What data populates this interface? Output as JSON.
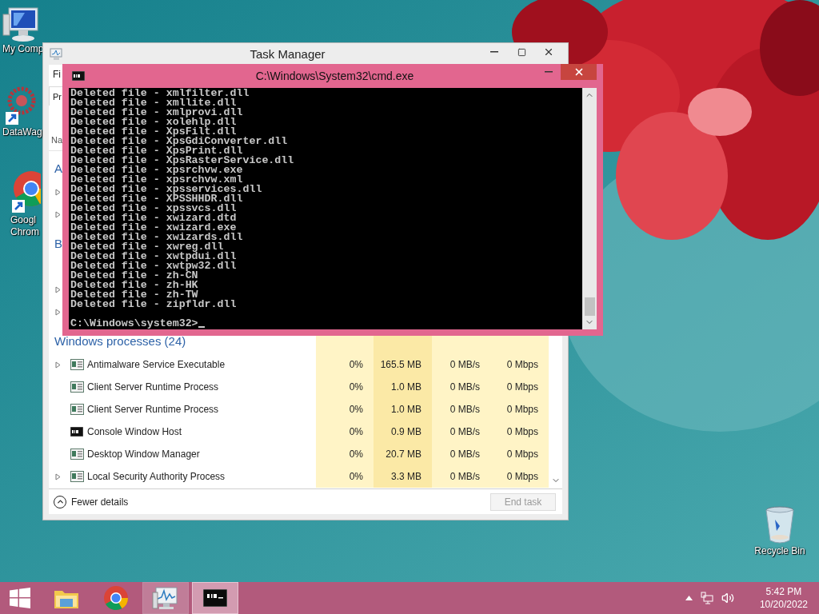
{
  "desktop": {
    "icons": [
      {
        "kind": "computer",
        "lines": [
          "My Comp"
        ]
      },
      {
        "kind": "shortcut_app",
        "lines": [
          "DataWag"
        ]
      },
      {
        "kind": "browser",
        "lines": [
          "Googl",
          "Chrom"
        ]
      },
      {
        "kind": "recycle_bin",
        "lines": [
          "Recycle Bin"
        ]
      }
    ]
  },
  "task_manager": {
    "title": "Task Manager",
    "menu": [
      "Fi"
    ],
    "tabs": [
      {
        "label": "Pr",
        "selected": true
      }
    ],
    "columns": [
      "Na"
    ],
    "groups": [
      {
        "heading": "A",
        "rows": [
          {
            "expandable": true
          },
          {
            "expandable": true
          }
        ]
      },
      {
        "heading": "B",
        "rows": [
          {
            "expandable": false
          },
          {
            "expandable": true
          },
          {
            "expandable": true
          }
        ]
      },
      {
        "heading": "Windows processes (24)",
        "rows": [
          {
            "expandable": true,
            "kind": "app",
            "name": "Antimalware Service Executable",
            "cpu": "0%",
            "memory": "165.5 MB",
            "disk": "0 MB/s",
            "network": "0 Mbps"
          },
          {
            "expandable": false,
            "kind": "app",
            "name": "Client Server Runtime Process",
            "cpu": "0%",
            "memory": "1.0 MB",
            "disk": "0 MB/s",
            "network": "0 Mbps"
          },
          {
            "expandable": false,
            "kind": "app",
            "name": "Client Server Runtime Process",
            "cpu": "0%",
            "memory": "1.0 MB",
            "disk": "0 MB/s",
            "network": "0 Mbps"
          },
          {
            "expandable": false,
            "kind": "console",
            "name": "Console Window Host",
            "cpu": "0%",
            "memory": "0.9 MB",
            "disk": "0 MB/s",
            "network": "0 Mbps"
          },
          {
            "expandable": false,
            "kind": "app",
            "name": "Desktop Window Manager",
            "cpu": "0%",
            "memory": "20.7 MB",
            "disk": "0 MB/s",
            "network": "0 Mbps"
          },
          {
            "expandable": true,
            "kind": "app",
            "name": "Local Security Authority Process",
            "cpu": "0%",
            "memory": "3.3 MB",
            "disk": "0 MB/s",
            "network": "0 Mbps"
          }
        ]
      }
    ],
    "fewer_details": "Fewer details",
    "end_task": {
      "label": "End task",
      "disabled": true
    }
  },
  "cmd": {
    "title": "C:\\Windows\\System32\\cmd.exe",
    "lines": [
      "Deleted file - xmlfilter.dll",
      "Deleted file - xmllite.dll",
      "Deleted file - xmlprovi.dll",
      "Deleted file - xolehlp.dll",
      "Deleted file - XpsFilt.dll",
      "Deleted file - XpsGdiConverter.dll",
      "Deleted file - XpsPrint.dll",
      "Deleted file - XpsRasterService.dll",
      "Deleted file - xpsrchvw.exe",
      "Deleted file - xpsrchvw.xml",
      "Deleted file - xpsservices.dll",
      "Deleted file - XPSSHHDR.dll",
      "Deleted file - xpssvcs.dll",
      "Deleted file - xwizard.dtd",
      "Deleted file - xwizard.exe",
      "Deleted file - xwizards.dll",
      "Deleted file - xwreg.dll",
      "Deleted file - xwtpdui.dll",
      "Deleted file - xwtpw32.dll",
      "Deleted file - zh-CN",
      "Deleted file - zh-HK",
      "Deleted file - zh-TW",
      "Deleted file - zipfldr.dll"
    ],
    "prompt": "C:\\Windows\\system32>"
  },
  "taskbar": {
    "apps": [
      {
        "kind": "explorer",
        "running": false,
        "selected": false
      },
      {
        "kind": "browser",
        "running": false,
        "selected": false
      },
      {
        "kind": "task_manager",
        "running": true,
        "selected": false
      },
      {
        "kind": "console",
        "running": true,
        "selected": true
      }
    ],
    "clock": {
      "time": "5:42 PM",
      "date": "10/20/2022"
    }
  }
}
